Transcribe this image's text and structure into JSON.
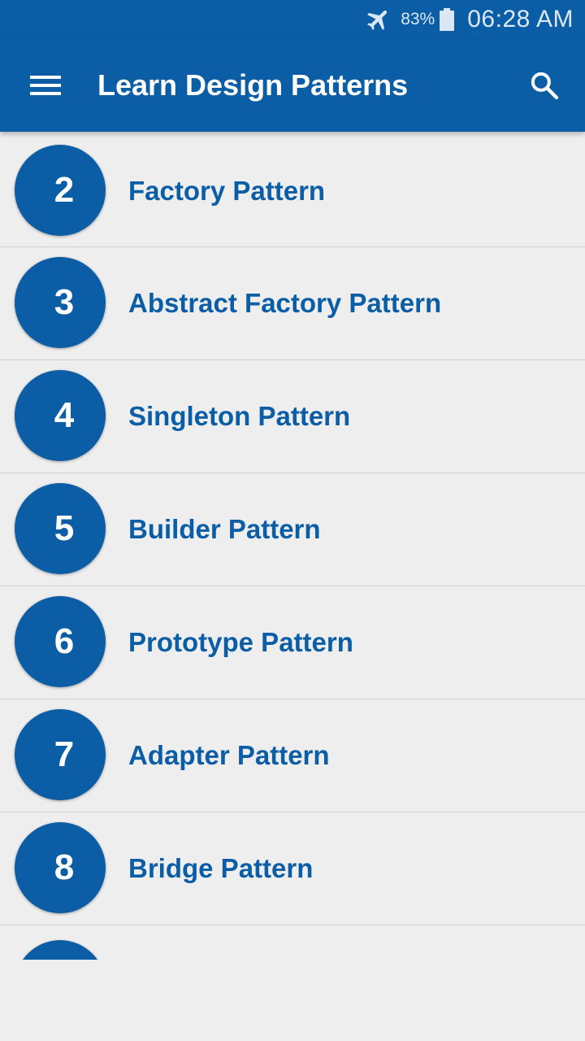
{
  "status_bar": {
    "icons": [
      "airplane-mode-icon",
      "battery-icon"
    ],
    "battery_percent": "83%",
    "time": "06:28 AM"
  },
  "app_bar": {
    "menu_icon": "hamburger-menu-icon",
    "title": "Learn Design Patterns",
    "search_icon": "search-icon"
  },
  "patterns": [
    {
      "number": "2",
      "label": "Factory Pattern"
    },
    {
      "number": "3",
      "label": "Abstract Factory Pattern"
    },
    {
      "number": "4",
      "label": "Singleton Pattern"
    },
    {
      "number": "5",
      "label": "Builder Pattern"
    },
    {
      "number": "6",
      "label": "Prototype Pattern"
    },
    {
      "number": "7",
      "label": "Adapter Pattern"
    },
    {
      "number": "8",
      "label": "Bridge Pattern"
    }
  ],
  "colors": {
    "primary": "#0b5ea6",
    "background": "#eeeeee",
    "divider": "#d2d2d2",
    "text_on_primary": "#ffffff"
  }
}
